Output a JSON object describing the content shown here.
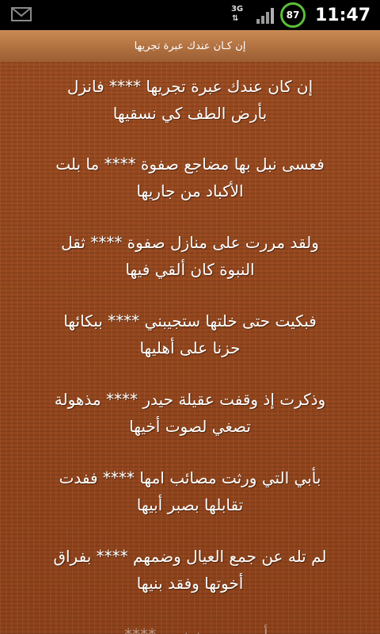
{
  "status_bar": {
    "left_icon": "gmail-icon",
    "network": "3G",
    "battery_level": "87",
    "time": "11:47",
    "colors": {
      "battery_ring": "#5bbf3a"
    }
  },
  "header": {
    "title": "إن كـان عندك عبرة تجريها"
  },
  "verses": [
    {
      "l1": "إن كان عندك عبرة تجريها **** فانزل",
      "l2": "بأرض الطف كي نسقيها"
    },
    {
      "l1": "فعسى نبل بها مضاجع صفوة **** ما بلت",
      "l2": "الأكباد من جاريها"
    },
    {
      "l1": "ولقد مررت على منازل صفوة **** ثقل",
      "l2": "النبوة كان ألقي فيها"
    },
    {
      "l1": "فبكيت حتى خلتها ستجيبني **** ببكائها",
      "l2": "حزنا على أهليها"
    },
    {
      "l1": "وذكرت إذ وقفت عقيلة حيدر **** مذهولة",
      "l2": "تصغي لصوت أخيها"
    },
    {
      "l1": "بأبي التي ورثت مصائب امها **** ففدت",
      "l2": "تقابلها بصبر أبيها"
    },
    {
      "l1": "لم تله عن جمع العيال وضمهم **** بفراق",
      "l2": "أخوتها وفقد بنيها"
    },
    {
      "l1": "وأمي من حزن ... **** ...",
      "l2": ""
    }
  ],
  "colors": {
    "content_background": "#9a4a1f",
    "header_background": "#b57544",
    "text": "#ffffff"
  }
}
